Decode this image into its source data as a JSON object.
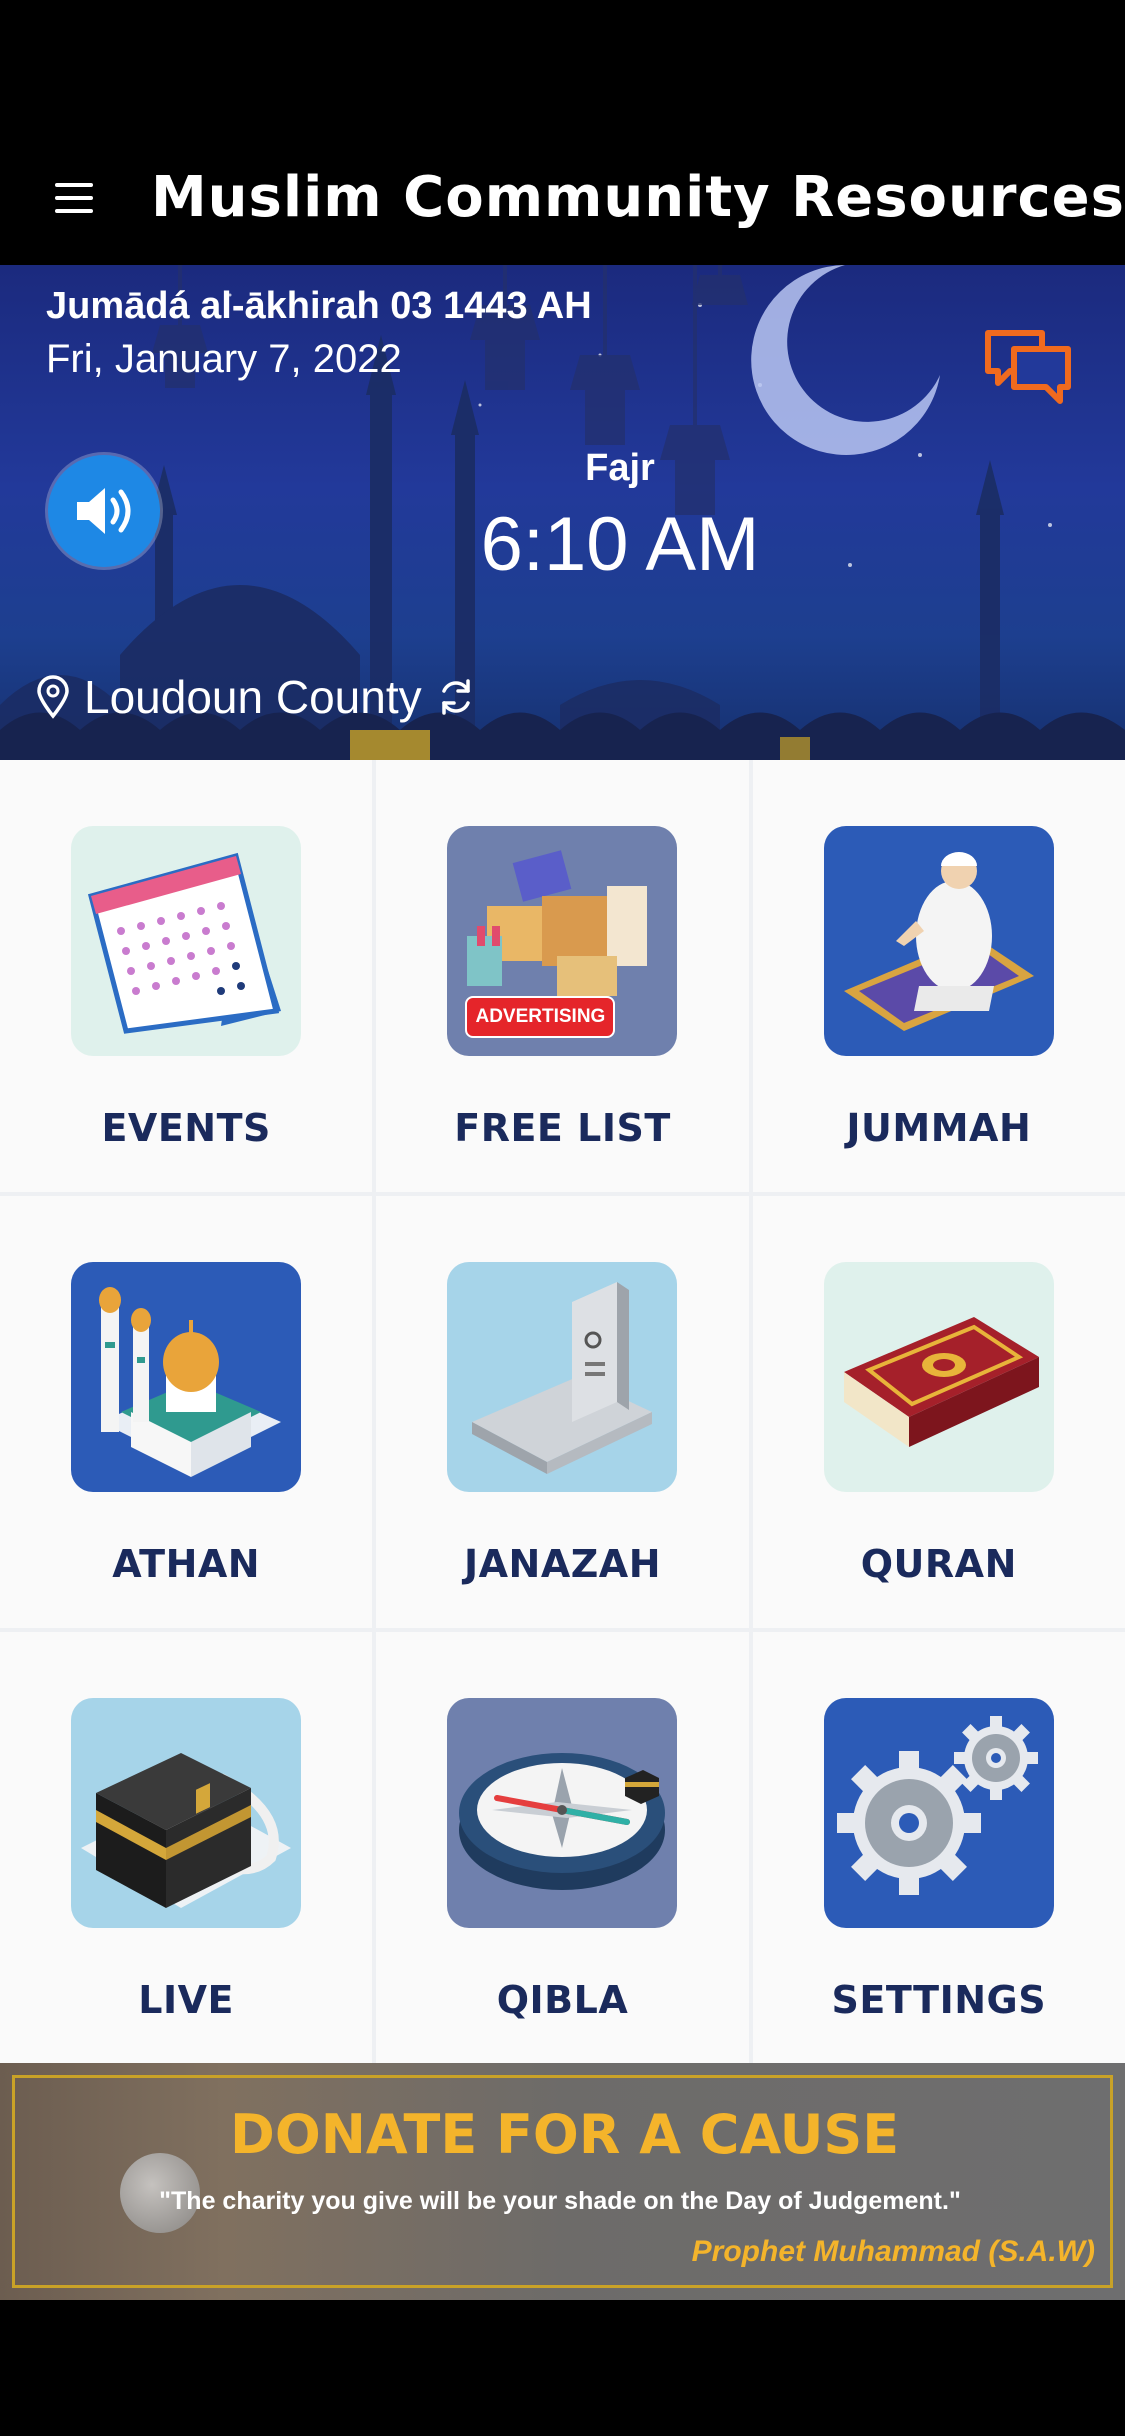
{
  "app_bar": {
    "title": "Muslim Community Resources",
    "menu_icon": "hamburger-menu-icon"
  },
  "hero": {
    "hijri_date": "Jumādá al-ākhirah 03 1443 AH",
    "gregorian_date": "Fri, January 7, 2022",
    "prayer_name": "Fajr",
    "prayer_time": "6:10 AM",
    "location": "Loudoun County",
    "icons": {
      "chat": "chat-bubbles-icon",
      "sound": "speaker-icon",
      "location": "location-pin-icon",
      "refresh": "refresh-icon"
    }
  },
  "tiles": [
    {
      "label": "EVENTS",
      "icon": "calendar-icon"
    },
    {
      "label": "FREE LIST",
      "icon": "shopping-icon",
      "badge": "ADVERTISING"
    },
    {
      "label": "JUMMAH",
      "icon": "praying-man-icon"
    },
    {
      "label": "ATHAN",
      "icon": "mosque-icon"
    },
    {
      "label": "JANAZAH",
      "icon": "grave-icon"
    },
    {
      "label": "QURAN",
      "icon": "quran-book-icon"
    },
    {
      "label": "LIVE",
      "icon": "kaaba-icon"
    },
    {
      "label": "QIBLA",
      "icon": "compass-icon"
    },
    {
      "label": "SETTINGS",
      "icon": "gears-icon"
    }
  ],
  "donate": {
    "title": "DONATE FOR A CAUSE",
    "quote": "\"The charity you give will be your shade on the Day of Judgement.\"",
    "attribution": "Prophet Muhammad (S.A.W)"
  },
  "colors": {
    "label": "#1a2a5c",
    "accent_orange": "#f06a1e",
    "donate_gold": "#f4b42b"
  }
}
